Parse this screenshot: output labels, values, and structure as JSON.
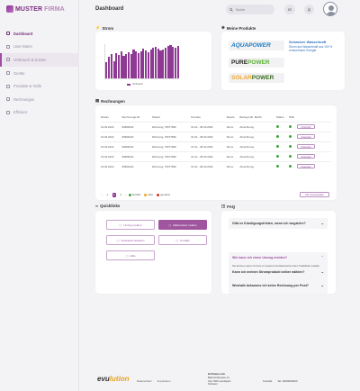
{
  "brand": {
    "bold": "MUSTER",
    "light": "FIRMA"
  },
  "sidebar": {
    "items": [
      {
        "label": "Dashboard",
        "active": true
      },
      {
        "label": "User-Daten",
        "active": false
      },
      {
        "label": "Verbrauch & Kosten",
        "active": false,
        "highlight": true
      },
      {
        "label": "Geräte",
        "active": false
      },
      {
        "label": "Produkte & Tarife",
        "active": false
      },
      {
        "label": "Rechnungen",
        "active": false
      },
      {
        "label": "Effizienz",
        "active": false
      }
    ]
  },
  "header": {
    "title": "Dashboard",
    "search_placeholder": "Suche",
    "lang": "DE"
  },
  "strom": {
    "title": "Strom",
    "legend": "Verbrauch",
    "values": [
      0.45,
      0.62,
      0.7,
      0.48,
      0.72,
      0.66,
      0.78,
      0.64,
      0.7,
      0.74,
      0.69,
      0.82,
      0.78,
      0.73,
      0.76,
      0.85,
      0.8,
      0.74,
      0.83,
      0.88,
      0.9,
      0.84,
      0.8,
      0.83,
      0.86,
      0.92,
      0.95,
      0.9,
      0.88,
      0.93
    ]
  },
  "products": {
    "title": "Meine Produkte",
    "aqua": {
      "a": "AQUA",
      "b": "POWER"
    },
    "pure": {
      "a": "PURE",
      "b": "POWER"
    },
    "solar": {
      "a": "SOLAR",
      "b": "POWER"
    },
    "note_title": "Schweizer Wasserkraft",
    "note_text": "Strom aus Wasserkraft aus 100 % erneuerbarer Energie"
  },
  "invoices": {
    "title": "Rechnungen",
    "columns": [
      "Datum",
      "Rechnungs-Nr.",
      "Objekt",
      "Periode",
      "Sparte",
      "Betrag inkl. MwSt.",
      "Status",
      "Hilfe"
    ],
    "rows": [
      {
        "date": "19.03.2024",
        "nr": "00996442",
        "obj": "Wohnung, 70677849",
        "period": "01.01 - 28.03.2024",
        "sparte": "Strom",
        "amount": "Abrechnung",
        "status": "#3ca73c",
        "btn": "Download"
      },
      {
        "date": "19.03.2024",
        "nr": "00996442",
        "obj": "Wohnung, 70677849",
        "period": "01.01 - 28.03.2024",
        "sparte": "Strom",
        "amount": "Abrechnung",
        "status": "#3ca73c",
        "btn": "Download"
      },
      {
        "date": "19.03.2024",
        "nr": "00996442",
        "obj": "Wohnung, 70677849",
        "period": "01.01 - 28.03.2024",
        "sparte": "Strom",
        "amount": "Abrechnung",
        "status": "#3ca73c",
        "btn": "Download"
      },
      {
        "date": "19.03.2024",
        "nr": "00996442",
        "obj": "Wohnung, 70677849",
        "period": "01.01 - 28.03.2024",
        "sparte": "Strom",
        "amount": "Abrechnung",
        "status": "#3ca73c",
        "btn": "Download"
      },
      {
        "date": "19.03.2024",
        "nr": "00996442",
        "obj": "Wohnung, 70677849",
        "period": "01.01 - 28.03.2024",
        "sparte": "Strom",
        "amount": "Abrechnung",
        "status": "#3ca73c",
        "btn": "Download"
      }
    ],
    "pages": [
      "1",
      "2",
      "3"
    ],
    "status_legend": [
      {
        "label": "bezahlt",
        "color": "#3ca73c"
      },
      {
        "label": "offen",
        "color": "#f0a52b"
      },
      {
        "label": "gemahnt",
        "color": "#d9302c"
      }
    ],
    "export": "Alle herunterladen"
  },
  "quicklinks": {
    "title": "Quicklinks",
    "buttons": [
      {
        "label": "Umzug melden",
        "filled": false
      },
      {
        "label": "Zählerstand melden",
        "filled": true
      },
      {
        "label": "Verbrauch ansehen",
        "filled": false
      },
      {
        "label": "Kontakt",
        "filled": false
      },
      {
        "label": "Hilfe",
        "filled": false
      }
    ]
  },
  "faq": {
    "title": "FAQ",
    "items": [
      "Gibt es Kündigungsfristen, wenn ich wegziehe?",
      "Kann ich meinen Stromprodukt selber wählen?",
      "Weshalb bekomme ich keine Rechnung per Post?"
    ],
    "open_q": "Wie kann ich einen Umzug melden?",
    "open_a": "Sie können einen Umzug in unserem Kundenportal unter Quicklinks melden. Wir senden Ihnen danach eine Bestätigung und eine Schlussrechnung."
  },
  "footer": {
    "logo_a": "evu",
    "logo_b": "lution",
    "links": [
      "Datenschutz",
      "Impressum"
    ],
    "addr_name": "EVUlution AG",
    "addr_lines": [
      "Bahnhofstrasse 11",
      "CH-7302 Landquart",
      "Schweiz"
    ],
    "contact": [
      "Kontakt",
      "Tel. 0000000000"
    ]
  }
}
